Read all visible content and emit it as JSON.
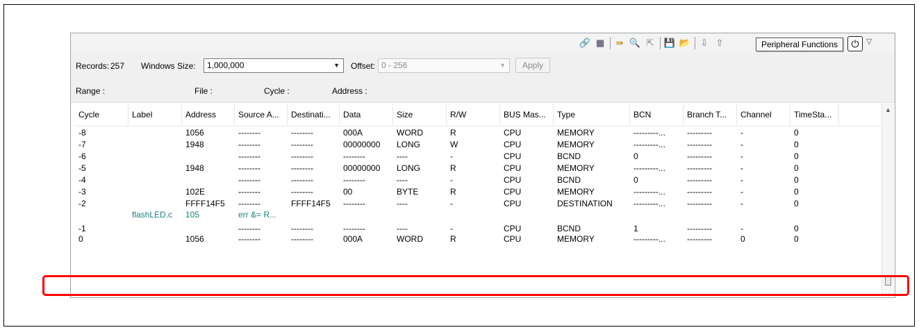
{
  "tooltip": "Peripheral Functions",
  "toolbar_icons": [
    "link-icon",
    "table-icon",
    "step-icon",
    "search-icon",
    "export-icon",
    "save-icon",
    "open-folder-icon",
    "filter-icon",
    "sort-icon",
    "power-icon"
  ],
  "controls": {
    "records_label": "Records:",
    "records_value": "257",
    "window_size_label": "Windows Size:",
    "window_size_value": "1,000,000",
    "offset_label": "Offset:",
    "offset_value": "0 - 256",
    "apply_label": "Apply"
  },
  "info": {
    "range_label": "Range :",
    "file_label": "File :",
    "cycle_label": "Cycle :",
    "address_label": "Address :"
  },
  "table": {
    "headers": [
      "Cycle",
      "Label",
      "Address",
      "Source A...",
      "Destinati...",
      "Data",
      "Size",
      "R/W",
      "BUS Mas...",
      "Type",
      "BCN",
      "Branch T...",
      "Channel",
      "TimeSta..."
    ],
    "rows": [
      [
        "-8",
        "",
        "1056",
        "--------",
        "--------",
        "000A",
        "WORD",
        "R",
        "CPU",
        "MEMORY",
        "---------...",
        "---------",
        "-",
        "0"
      ],
      [
        "-7",
        "",
        "1948",
        "--------",
        "--------",
        "00000000",
        "LONG",
        "W",
        "CPU",
        "MEMORY",
        "---------...",
        "---------",
        "-",
        "0"
      ],
      [
        "-6",
        "",
        "",
        "--------",
        "--------",
        "--------",
        "----",
        "-",
        "CPU",
        "BCND",
        "0",
        "---------",
        "-",
        "0"
      ],
      [
        "-5",
        "",
        "1948",
        "--------",
        "--------",
        "00000000",
        "LONG",
        "R",
        "CPU",
        "MEMORY",
        "---------...",
        "---------",
        "-",
        "0"
      ],
      [
        "-4",
        "",
        "",
        "--------",
        "--------",
        "--------",
        "----",
        "-",
        "CPU",
        "BCND",
        "0",
        "---------",
        "-",
        "0"
      ],
      [
        "-3",
        "",
        "102E",
        "--------",
        "--------",
        "00",
        "BYTE",
        "R",
        "CPU",
        "MEMORY",
        "---------...",
        "---------",
        "-",
        "0"
      ],
      [
        "-2",
        "",
        "FFFF14F5",
        "--------",
        "FFFF14F5",
        "--------",
        "----",
        "-",
        "CPU",
        "DESTINATION",
        "---------...",
        "---------",
        "-",
        "0"
      ],
      [
        "",
        "flashLED.c",
        "105",
        "err &= R...",
        "",
        "",
        "",
        "",
        "",
        "",
        "",
        "",
        "",
        ""
      ],
      [
        "-1",
        "",
        "",
        "--------",
        "--------",
        "--------",
        "----",
        "-",
        "CPU",
        "BCND",
        "1",
        "---------",
        "-",
        "0"
      ],
      [
        "0",
        "",
        "1056",
        "--------",
        "--------",
        "000A",
        "WORD",
        "R",
        "CPU",
        "MEMORY",
        "---------...",
        "---------",
        "0",
        "0"
      ]
    ]
  },
  "colors": {
    "highlight": "#ff0000",
    "source_line": "#1a8080"
  }
}
